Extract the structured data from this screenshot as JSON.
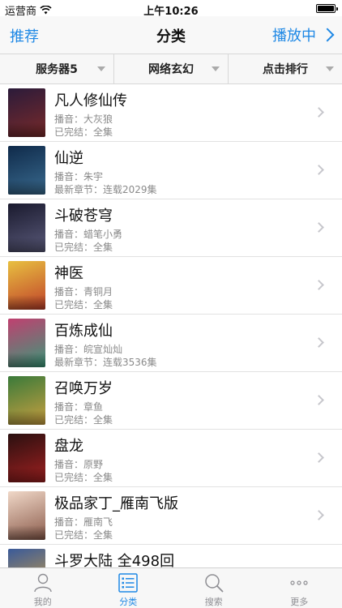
{
  "status_bar": {
    "carrier": "运营商",
    "time": "上午10:26"
  },
  "nav": {
    "left": "推荐",
    "title": "分类",
    "right": "播放中"
  },
  "filters": [
    {
      "label": "服务器5"
    },
    {
      "label": "网络玄幻"
    },
    {
      "label": "点击排行"
    }
  ],
  "items": [
    {
      "title": "凡人修仙传",
      "line1": "播音：大灰狼",
      "line2": "已完结：全集",
      "cover": [
        "#2b1b3a",
        "#7a2a2a"
      ]
    },
    {
      "title": "仙逆",
      "line1": "播音：朱宇",
      "line2": "最新章节：连载2029集",
      "cover": [
        "#0f2a4a",
        "#3a6b8f"
      ]
    },
    {
      "title": "斗破苍穹",
      "line1": "播音：蜡笔小勇",
      "line2": "已完结：全集",
      "cover": [
        "#1a1a2e",
        "#5a5a7a"
      ]
    },
    {
      "title": "神医",
      "line1": "播音：青铜月",
      "line2": "已完结：全集",
      "cover": [
        "#e8c040",
        "#c0402a"
      ]
    },
    {
      "title": "百炼成仙",
      "line1": "播音：皖宣灿灿",
      "line2": "最新章节：连载3536集",
      "cover": [
        "#c04070",
        "#3a9a7a"
      ]
    },
    {
      "title": "召唤万岁",
      "line1": "播音：章鱼",
      "line2": "已完结：全集",
      "cover": [
        "#3a7a3a",
        "#caa040"
      ]
    },
    {
      "title": "盘龙",
      "line1": "播音：原野",
      "line2": "已完结：全集",
      "cover": [
        "#2a1010",
        "#a02020"
      ]
    },
    {
      "title": "极品家丁_雁南飞版",
      "line1": "播音：雁南飞",
      "line2": "已完结：全集",
      "cover": [
        "#f0d8c8",
        "#8a5a4a"
      ]
    },
    {
      "title": "斗罗大陆 全498回",
      "line1": "",
      "line2": "",
      "cover": [
        "#3a5a9a",
        "#d0a040"
      ]
    }
  ],
  "tabs": [
    {
      "label": "我的",
      "icon": "person-icon",
      "active": false
    },
    {
      "label": "分类",
      "icon": "list-icon",
      "active": true
    },
    {
      "label": "搜索",
      "icon": "search-icon",
      "active": false
    },
    {
      "label": "更多",
      "icon": "more-icon",
      "active": false
    }
  ],
  "colors": {
    "accent": "#1e88e5",
    "inactive": "#8e8e93"
  }
}
